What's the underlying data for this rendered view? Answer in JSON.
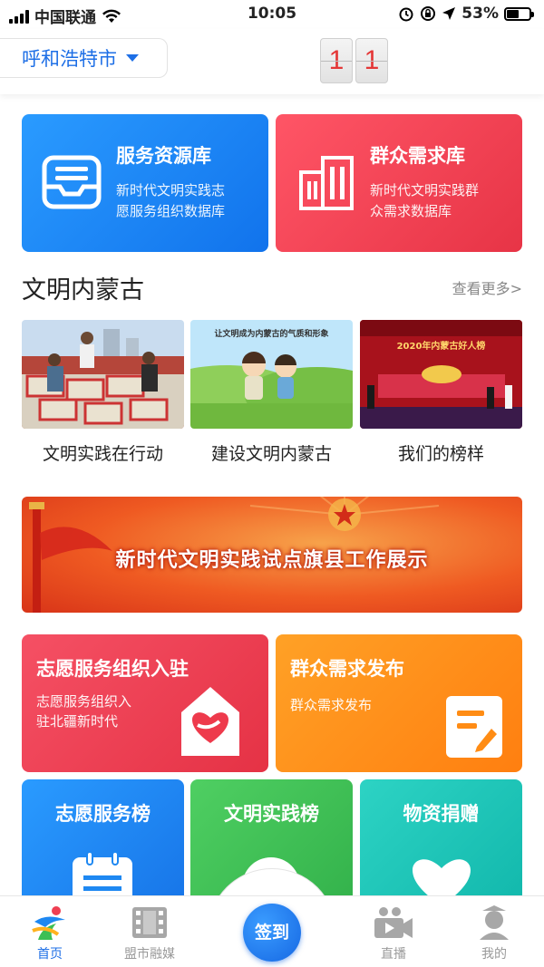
{
  "status_bar": {
    "carrier": "中国联通",
    "time": "10:05",
    "battery": "53%"
  },
  "header": {
    "city": "呼和浩特市",
    "counter_digits": [
      "1",
      "1"
    ]
  },
  "resource_cards": [
    {
      "title": "服务资源库",
      "desc_line1": "新时代文明实践志",
      "desc_line2": "愿服务组织数据库",
      "color": "#1e88f2"
    },
    {
      "title": "群众需求库",
      "desc_line1": "新时代文明实践群",
      "desc_line2": "众需求数据库",
      "color": "#ef3f52"
    }
  ],
  "section": {
    "title": "文明内蒙古",
    "more": "查看更多>",
    "items": [
      {
        "caption": "文明实践在行动"
      },
      {
        "caption": "建设文明内蒙古",
        "image_text": "让文明成为内蒙古的气质和形象"
      },
      {
        "caption": "我们的榜样",
        "image_text": "2020年内蒙古好人榜"
      }
    ]
  },
  "banner": {
    "text": "新时代文明实践试点旗县工作展示"
  },
  "tiles": [
    {
      "title": "志愿服务组织入驻",
      "desc_line1": "志愿服务组织入",
      "desc_line2": "驻北疆新时代",
      "color": "#ee3a4c"
    },
    {
      "title": "群众需求发布",
      "desc_line1": "群众需求发布",
      "color": "#ff8c14"
    }
  ],
  "lists": [
    {
      "title": "志愿服务榜",
      "color": "#1e88f2"
    },
    {
      "title": "文明实践榜",
      "color": "#3cbf55"
    },
    {
      "title": "物资捐赠",
      "color": "#19c4b8"
    }
  ],
  "tabbar": {
    "items": [
      {
        "label": "首页",
        "icon": "home-logo-icon",
        "active": true
      },
      {
        "label": "盟市融媒",
        "icon": "film-icon"
      },
      {
        "label": "直播",
        "icon": "live-camera-icon"
      },
      {
        "label": "我的",
        "icon": "profile-icon"
      }
    ],
    "checkin": "签到"
  }
}
